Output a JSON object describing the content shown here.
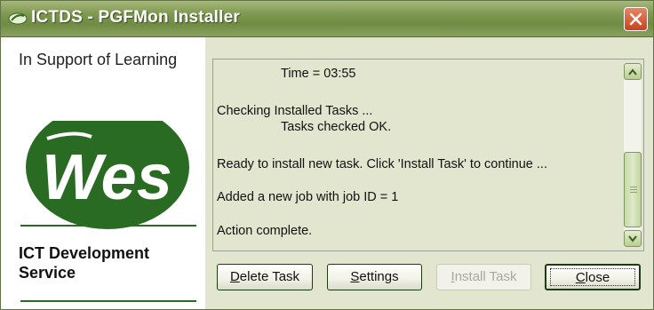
{
  "window": {
    "title": "ICTDS - PGFMon Installer",
    "icon": "app-leaf-icon",
    "close_icon": "close-icon"
  },
  "branding": {
    "tagline": "In Support of Learning",
    "logo_text": "Wes",
    "service_name": "ICT Development Service"
  },
  "log": {
    "lines": [
      "Time = 03:55",
      "Checking Installed Tasks ...",
      "Tasks checked OK.",
      "Ready to install new task. Click 'Install Task' to continue ...",
      "Added a new job with job ID = 1",
      "Action complete."
    ]
  },
  "buttons": {
    "delete_prefix": "D",
    "delete_rest": "elete Task",
    "settings_prefix": "S",
    "settings_rest": "ettings",
    "install_prefix": "I",
    "install_rest": "nstall Task",
    "close_prefix": "C",
    "close_rest": "lose"
  },
  "colors": {
    "titlebar": "#7f9a52",
    "logo_green": "#2a6b24",
    "dialog_bg": "#e3e6cf",
    "close_red": "#d4552f"
  }
}
